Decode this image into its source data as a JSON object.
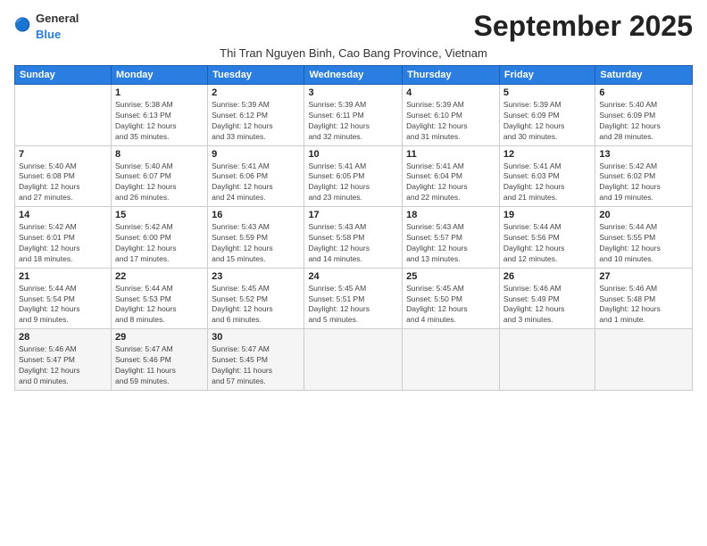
{
  "logo": {
    "general": "General",
    "blue": "Blue"
  },
  "header": {
    "month": "September 2025",
    "location": "Thi Tran Nguyen Binh, Cao Bang Province, Vietnam"
  },
  "days_of_week": [
    "Sunday",
    "Monday",
    "Tuesday",
    "Wednesday",
    "Thursday",
    "Friday",
    "Saturday"
  ],
  "weeks": [
    [
      {
        "day": "",
        "info": ""
      },
      {
        "day": "1",
        "info": "Sunrise: 5:38 AM\nSunset: 6:13 PM\nDaylight: 12 hours\nand 35 minutes."
      },
      {
        "day": "2",
        "info": "Sunrise: 5:39 AM\nSunset: 6:12 PM\nDaylight: 12 hours\nand 33 minutes."
      },
      {
        "day": "3",
        "info": "Sunrise: 5:39 AM\nSunset: 6:11 PM\nDaylight: 12 hours\nand 32 minutes."
      },
      {
        "day": "4",
        "info": "Sunrise: 5:39 AM\nSunset: 6:10 PM\nDaylight: 12 hours\nand 31 minutes."
      },
      {
        "day": "5",
        "info": "Sunrise: 5:39 AM\nSunset: 6:09 PM\nDaylight: 12 hours\nand 30 minutes."
      },
      {
        "day": "6",
        "info": "Sunrise: 5:40 AM\nSunset: 6:09 PM\nDaylight: 12 hours\nand 28 minutes."
      }
    ],
    [
      {
        "day": "7",
        "info": "Sunrise: 5:40 AM\nSunset: 6:08 PM\nDaylight: 12 hours\nand 27 minutes."
      },
      {
        "day": "8",
        "info": "Sunrise: 5:40 AM\nSunset: 6:07 PM\nDaylight: 12 hours\nand 26 minutes."
      },
      {
        "day": "9",
        "info": "Sunrise: 5:41 AM\nSunset: 6:06 PM\nDaylight: 12 hours\nand 24 minutes."
      },
      {
        "day": "10",
        "info": "Sunrise: 5:41 AM\nSunset: 6:05 PM\nDaylight: 12 hours\nand 23 minutes."
      },
      {
        "day": "11",
        "info": "Sunrise: 5:41 AM\nSunset: 6:04 PM\nDaylight: 12 hours\nand 22 minutes."
      },
      {
        "day": "12",
        "info": "Sunrise: 5:41 AM\nSunset: 6:03 PM\nDaylight: 12 hours\nand 21 minutes."
      },
      {
        "day": "13",
        "info": "Sunrise: 5:42 AM\nSunset: 6:02 PM\nDaylight: 12 hours\nand 19 minutes."
      }
    ],
    [
      {
        "day": "14",
        "info": "Sunrise: 5:42 AM\nSunset: 6:01 PM\nDaylight: 12 hours\nand 18 minutes."
      },
      {
        "day": "15",
        "info": "Sunrise: 5:42 AM\nSunset: 6:00 PM\nDaylight: 12 hours\nand 17 minutes."
      },
      {
        "day": "16",
        "info": "Sunrise: 5:43 AM\nSunset: 5:59 PM\nDaylight: 12 hours\nand 15 minutes."
      },
      {
        "day": "17",
        "info": "Sunrise: 5:43 AM\nSunset: 5:58 PM\nDaylight: 12 hours\nand 14 minutes."
      },
      {
        "day": "18",
        "info": "Sunrise: 5:43 AM\nSunset: 5:57 PM\nDaylight: 12 hours\nand 13 minutes."
      },
      {
        "day": "19",
        "info": "Sunrise: 5:44 AM\nSunset: 5:56 PM\nDaylight: 12 hours\nand 12 minutes."
      },
      {
        "day": "20",
        "info": "Sunrise: 5:44 AM\nSunset: 5:55 PM\nDaylight: 12 hours\nand 10 minutes."
      }
    ],
    [
      {
        "day": "21",
        "info": "Sunrise: 5:44 AM\nSunset: 5:54 PM\nDaylight: 12 hours\nand 9 minutes."
      },
      {
        "day": "22",
        "info": "Sunrise: 5:44 AM\nSunset: 5:53 PM\nDaylight: 12 hours\nand 8 minutes."
      },
      {
        "day": "23",
        "info": "Sunrise: 5:45 AM\nSunset: 5:52 PM\nDaylight: 12 hours\nand 6 minutes."
      },
      {
        "day": "24",
        "info": "Sunrise: 5:45 AM\nSunset: 5:51 PM\nDaylight: 12 hours\nand 5 minutes."
      },
      {
        "day": "25",
        "info": "Sunrise: 5:45 AM\nSunset: 5:50 PM\nDaylight: 12 hours\nand 4 minutes."
      },
      {
        "day": "26",
        "info": "Sunrise: 5:46 AM\nSunset: 5:49 PM\nDaylight: 12 hours\nand 3 minutes."
      },
      {
        "day": "27",
        "info": "Sunrise: 5:46 AM\nSunset: 5:48 PM\nDaylight: 12 hours\nand 1 minute."
      }
    ],
    [
      {
        "day": "28",
        "info": "Sunrise: 5:46 AM\nSunset: 5:47 PM\nDaylight: 12 hours\nand 0 minutes."
      },
      {
        "day": "29",
        "info": "Sunrise: 5:47 AM\nSunset: 5:46 PM\nDaylight: 11 hours\nand 59 minutes."
      },
      {
        "day": "30",
        "info": "Sunrise: 5:47 AM\nSunset: 5:45 PM\nDaylight: 11 hours\nand 57 minutes."
      },
      {
        "day": "",
        "info": ""
      },
      {
        "day": "",
        "info": ""
      },
      {
        "day": "",
        "info": ""
      },
      {
        "day": "",
        "info": ""
      }
    ]
  ]
}
